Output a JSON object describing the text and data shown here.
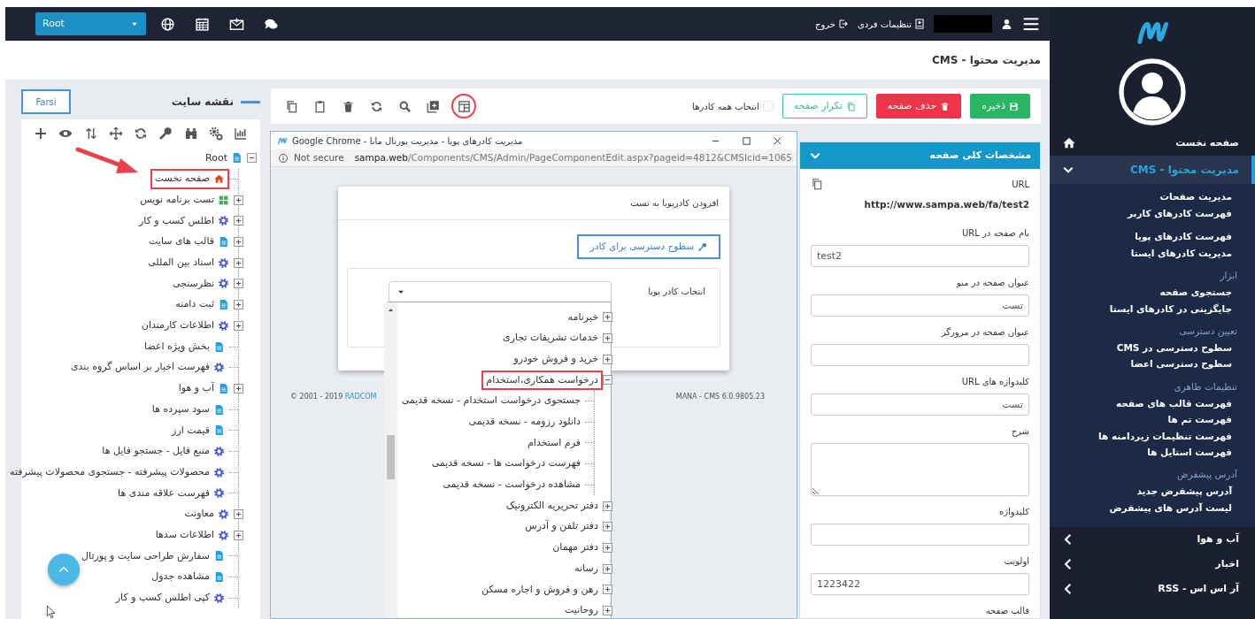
{
  "topbar": {
    "root_select": "Root",
    "links": [
      {
        "label": "تنظیمات فردی",
        "kind": "settings"
      },
      {
        "label": "خروج",
        "kind": "logout"
      }
    ]
  },
  "page_title": "مدیریت محتوا - CMS",
  "toolbar": {
    "buttons": [
      {
        "label": "ذخیره",
        "kind": "save"
      },
      {
        "label": "حذف صفحه",
        "kind": "delete"
      },
      {
        "label": "تکرار صفحه",
        "kind": "duplicate"
      }
    ],
    "select_all": {
      "label": "انتخاب همه کادرها",
      "checked": false
    },
    "tools": [
      {
        "kind": "layout",
        "highlighted": true
      },
      {
        "kind": "plus-square",
        "highlighted": false
      },
      {
        "kind": "search",
        "highlighted": false
      },
      {
        "kind": "refresh",
        "highlighted": false
      },
      {
        "kind": "trash",
        "highlighted": false
      },
      {
        "kind": "clipboard",
        "highlighted": false
      },
      {
        "kind": "copy",
        "highlighted": false
      }
    ]
  },
  "sitemap": {
    "title": "نقشه سایت",
    "language_button": "Farsi",
    "tree": {
      "label": "Root",
      "kind": "page",
      "expanded": true,
      "highlighted": false,
      "children": [
        {
          "label": "صفحه نخست",
          "kind": "home",
          "highlighted": true
        },
        {
          "label": "تست برنامه نویس",
          "kind": "grid",
          "expanded": false,
          "highlighted": false
        },
        {
          "label": "اطلس کسب و کار",
          "kind": "gear",
          "expanded": false,
          "highlighted": false
        },
        {
          "label": "قالب های سایت",
          "kind": "page",
          "expanded": false,
          "highlighted": false
        },
        {
          "label": "اسناد بین المللی",
          "kind": "gear",
          "expanded": false,
          "highlighted": false
        },
        {
          "label": "نظرسنجی",
          "kind": "gear",
          "expanded": false,
          "highlighted": false
        },
        {
          "label": "ثبت دامنه",
          "kind": "page",
          "expanded": false,
          "highlighted": false
        },
        {
          "label": "اطلاعات کارمندان",
          "kind": "gear",
          "expanded": false,
          "highlighted": false
        },
        {
          "label": "بخش ویژه اعضا",
          "kind": "page",
          "highlighted": false
        },
        {
          "label": "فهرست اخبار بر اساس گروه بندی",
          "kind": "gear",
          "highlighted": false
        },
        {
          "label": "آب و هوا",
          "kind": "page",
          "expanded": false,
          "highlighted": false
        },
        {
          "label": "سود سپرده ها",
          "kind": "page",
          "highlighted": false
        },
        {
          "label": "قیمت ارز",
          "kind": "page",
          "highlighted": false
        },
        {
          "label": "منبع فایل - جستجو فایل ها",
          "kind": "gear",
          "highlighted": false
        },
        {
          "label": "محصولات پیشرفته - جستجوی محصولات پیشرفته",
          "kind": "gear",
          "highlighted": false
        },
        {
          "label": "فهرست علاقه مندی ها",
          "kind": "gear",
          "highlighted": false
        },
        {
          "label": "معاونت",
          "kind": "gear",
          "expanded": false,
          "highlighted": false
        },
        {
          "label": "اطلاعات سدها",
          "kind": "gear",
          "expanded": false,
          "highlighted": false
        },
        {
          "label": "سفارش طراحی سایت و پورتال",
          "kind": "page",
          "highlighted": false
        },
        {
          "label": "مشاهده جدول",
          "kind": "page",
          "highlighted": false
        },
        {
          "label": "کپی اطلس کسب و کار",
          "kind": "gear",
          "highlighted": false
        }
      ]
    }
  },
  "popup": {
    "title": "مدیریت کادرهای پویا - مدیریت پورتال مانا - Google Chrome",
    "security": "Not secure",
    "url_host": "sampa.web",
    "url_path": "/Components/CMS/Admin/PageComponentEdit.aspx?pageid=4812&CMSIcid=1065",
    "modal": {
      "title": "افزودن کادرپویا به تست",
      "access_button": "سطوح دسترسی برای کادر",
      "select_label": "انتخاب کادر پویا",
      "options": [
        {
          "label": "خبرنامه",
          "expanded": false,
          "highlighted": false
        },
        {
          "label": "خدمات تشریفات تجاری",
          "expanded": false,
          "highlighted": false
        },
        {
          "label": "خرید و فروش خودرو",
          "expanded": false,
          "highlighted": false
        },
        {
          "label": "درخواست همکاری،استخدام",
          "expanded": true,
          "highlighted": true,
          "children": [
            {
              "label": "جستجوی درخواست استخدام - نسخه قدیمی",
              "highlighted": false
            },
            {
              "label": "دانلود رزومه - نسخه قدیمی",
              "highlighted": false
            },
            {
              "label": "فرم استخدام",
              "highlighted": false
            },
            {
              "label": "فهرست درخواست ها - نسخه قدیمی",
              "highlighted": false
            },
            {
              "label": "مشاهده درخواست - نسخه قدیمی",
              "highlighted": false
            }
          ]
        },
        {
          "label": "دفتر تحریریه الکترونیک",
          "expanded": false,
          "highlighted": false
        },
        {
          "label": "دفتر تلفن و آدرس",
          "expanded": false,
          "highlighted": false
        },
        {
          "label": "دفتر مهمان",
          "expanded": false,
          "highlighted": false
        },
        {
          "label": "رسانه",
          "expanded": false,
          "highlighted": false
        },
        {
          "label": "رهن و فروش و اجاره مسکن",
          "expanded": false,
          "highlighted": false
        },
        {
          "label": "روحانیت",
          "expanded": false,
          "highlighted": false
        }
      ]
    },
    "footer": {
      "copyright": "© 2001 - 2019",
      "company": "RADCOM",
      "version": "MANA - CMS 6.0.9805.23"
    }
  },
  "properties": {
    "title": "مشخصات کلی صفحه",
    "expanded": true,
    "url_label": "URL",
    "url": "http://www.sampa.web/fa/test2",
    "fields": [
      {
        "label": "نام صفحه در URL",
        "value": "test2",
        "kind": "input"
      },
      {
        "label": "عنوان صفحه در منو",
        "value": "تست",
        "kind": "input"
      },
      {
        "label": "عنوان صفحه در مرورگر",
        "kind": "input"
      },
      {
        "label": "کلیدواژه های URL",
        "value": "تست",
        "kind": "input"
      },
      {
        "label": "شرح",
        "kind": "textarea"
      },
      {
        "label": "کلیدواژه",
        "kind": "input"
      },
      {
        "label": "اولویت",
        "value": "1223422",
        "kind": "input"
      },
      {
        "label": "قالب صفحه",
        "kind": "label"
      }
    ]
  },
  "sidebar": {
    "items": [
      {
        "label": "صفحه نخست",
        "kind": "home",
        "selected": false
      },
      {
        "label": "مدیریت محتوا - CMS",
        "kind": "group",
        "selected": true,
        "expanded": true,
        "sections": [
          {
            "items": [
              "مدیریت صفحات",
              "فهرست کادرهای کاربر"
            ]
          },
          {
            "items": [
              "فهرست کادرهای پویا",
              "مدیریت کادرهای ایستا"
            ]
          },
          {
            "heading": "ابزار",
            "items": [
              "جستجوی صفحه",
              "جایگزینی در کادرهای ایستا"
            ]
          },
          {
            "heading": "تعیین دسترسی",
            "items": [
              "سطوح دسترسی در CMS",
              "سطوح دسترسی اعضا"
            ]
          },
          {
            "heading": "تنظیمات ظاهری",
            "items": [
              "فهرست قالب های صفحه",
              "فهرست تم ها",
              "فهرست تنظیمات زیردامنه ها",
              "فهرست استایل ها"
            ]
          },
          {
            "heading": "آدرس پیشفرض",
            "items": [
              "آدرس پیشفرض جدید",
              "لیست آدرس های پیشفرض"
            ]
          }
        ]
      },
      {
        "label": "آب و هوا",
        "kind": "group",
        "selected": false,
        "expanded": false
      },
      {
        "label": "اخبار",
        "kind": "group",
        "selected": false,
        "expanded": false
      },
      {
        "label": "آر اس اس - RSS",
        "kind": "group",
        "selected": false,
        "expanded": false
      }
    ]
  }
}
